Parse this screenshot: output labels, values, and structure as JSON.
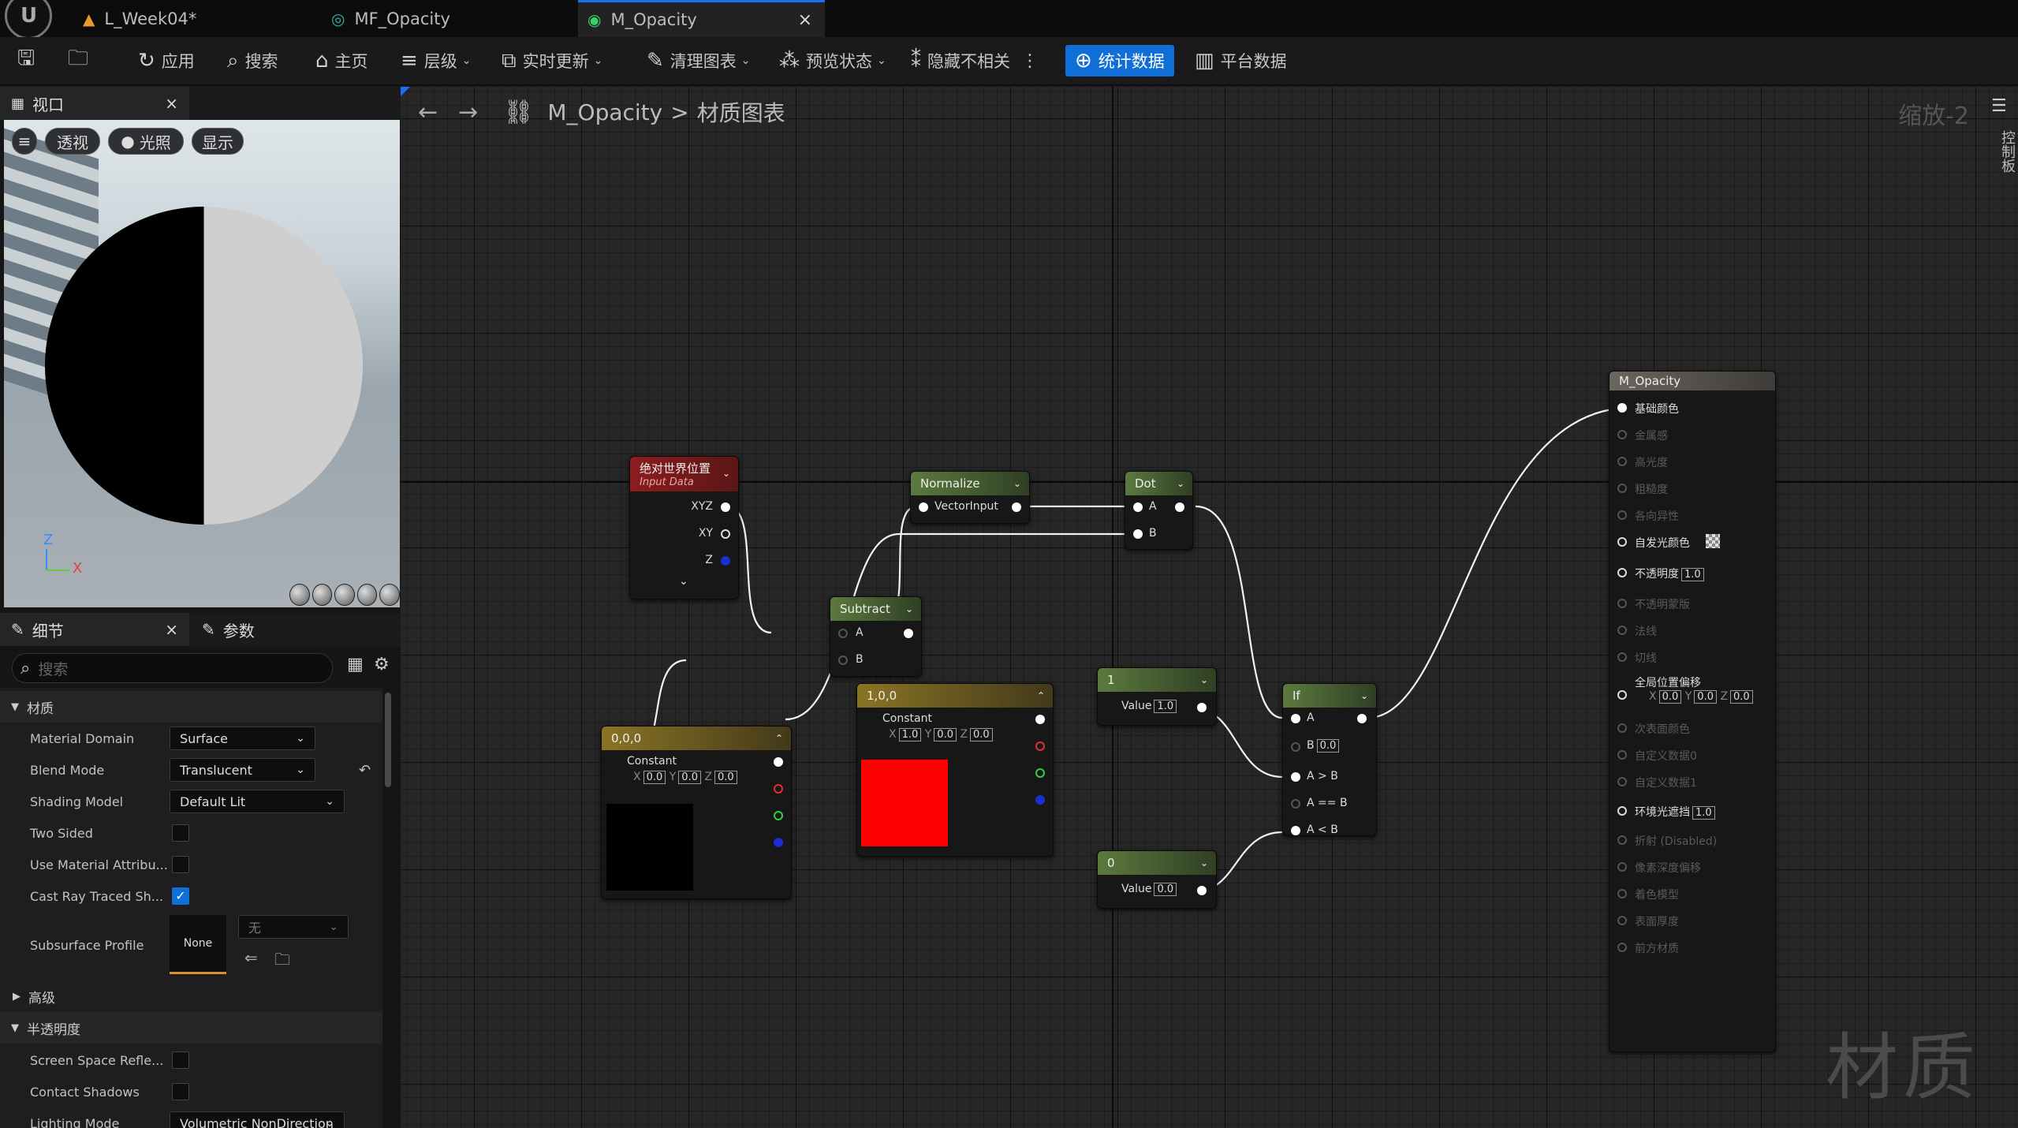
{
  "tabs": [
    {
      "label": "L_Week04*"
    },
    {
      "label": "MF_Opacity"
    },
    {
      "label": "M_Opacity",
      "close": "×"
    }
  ],
  "toolbar": {
    "apply": "应用",
    "search": "搜索",
    "home": "主页",
    "hierarchy": "层级",
    "live_update": "实时更新",
    "clean_graph": "清理图表",
    "preview_state": "预览状态",
    "hide_unrelated": "隐藏不相关",
    "stats": "统计数据",
    "platform_stats": "平台数据"
  },
  "viewport": {
    "tab": "视口",
    "close": "×",
    "perspective": "透视",
    "lit": "光照",
    "show": "显示",
    "axis_z": "Z",
    "axis_x": "X"
  },
  "details": {
    "tab_details": "细节",
    "tab_params": "参数",
    "close": "×",
    "search_placeholder": "搜索",
    "cat_material": "材质",
    "material_domain_label": "Material Domain",
    "material_domain_value": "Surface",
    "blend_mode_label": "Blend Mode",
    "blend_mode_value": "Translucent",
    "shading_model_label": "Shading Model",
    "shading_model_value": "Default Lit",
    "two_sided_label": "Two Sided",
    "use_material_attr_label": "Use Material Attribu...",
    "cast_ray_label": "Cast Ray Traced Sh...",
    "subsurface_label": "Subsurface Profile",
    "subsurface_none": "None",
    "subsurface_combo": "无",
    "cat_advanced": "高级",
    "cat_translucency": "半透明度",
    "ssr_label": "Screen Space Refle...",
    "contact_shadows_label": "Contact Shadows",
    "lighting_mode_label": "Lighting Mode",
    "lighting_mode_value": "Volumetric NonDirection"
  },
  "graph": {
    "breadcrumb_asset": "M_Opacity",
    "breadcrumb_sep": ">",
    "breadcrumb_graph": "材质图表",
    "zoom": "缩放-2",
    "watermark": "材质",
    "side_panel": "控制板"
  },
  "nodes": {
    "abs_world_pos": {
      "title": "绝对世界位置",
      "subtitle": "Input Data",
      "out_xyz": "XYZ",
      "out_xy": "XY",
      "out_z": "Z"
    },
    "normalize": {
      "title": "Normalize",
      "in": "VectorInput"
    },
    "dot": {
      "title": "Dot",
      "a": "A",
      "b": "B"
    },
    "subtract": {
      "title": "Subtract",
      "a": "A",
      "b": "B"
    },
    "const_black": {
      "title": "0,0,0",
      "label": "Constant",
      "x": "X",
      "y": "Y",
      "z": "Z",
      "xv": "0.0",
      "yv": "0.0",
      "zv": "0.0",
      "color": "#000000"
    },
    "const_red": {
      "title": "1,0,0",
      "label": "Constant",
      "x": "X",
      "y": "Y",
      "z": "Z",
      "xv": "1.0",
      "yv": "0.0",
      "zv": "0.0",
      "color": "#ff0000"
    },
    "const_one": {
      "title": "1",
      "label": "Value",
      "v": "1.0"
    },
    "const_zero": {
      "title": "0",
      "label": "Value",
      "v": "0.0"
    },
    "if_node": {
      "title": "If",
      "a": "A",
      "b": "B",
      "bv": "0.0",
      "gt": "A > B",
      "eq": "A == B",
      "lt": "A < B"
    },
    "result": {
      "title": "M_Opacity",
      "base_color": "基础颜色",
      "metallic": "金属感",
      "specular": "高光度",
      "roughness": "粗糙度",
      "anisotropy": "各向异性",
      "emissive": "自发光颜色",
      "opacity": "不透明度",
      "opacity_value": "1.0",
      "opacity_mask": "不透明蒙版",
      "normal": "法线",
      "tangent": "切线",
      "wpo": "全局位置偏移",
      "wpo_x": "X",
      "wpo_y": "Y",
      "wpo_z": "Z",
      "wpo_xv": "0.0",
      "wpo_yv": "0.0",
      "wpo_zv": "0.0",
      "subsurface": "次表面颜色",
      "custom0": "自定义数据0",
      "custom1": "自定义数据1",
      "ao": "环境光遮挡",
      "ao_value": "1.0",
      "refraction": "折射 (Disabled)",
      "pixel_depth": "像素深度偏移",
      "shading_model": "着色模型",
      "surface_thickness": "表面厚度",
      "front_material": "前方材质"
    }
  },
  "colors": {
    "accent": "#0f6fd6",
    "stats_button": "#0f6fd6"
  }
}
